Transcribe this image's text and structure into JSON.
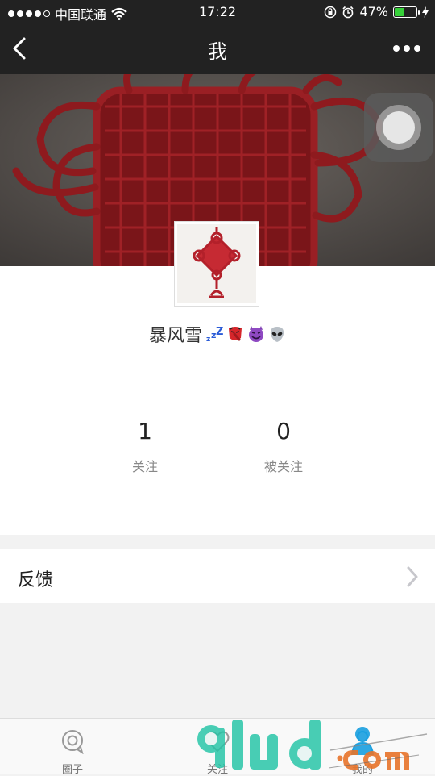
{
  "status_bar": {
    "carrier": "中国联通",
    "time": "17:22",
    "battery": "47%",
    "battery_level": 0.47
  },
  "nav": {
    "title": "我"
  },
  "profile": {
    "username": "暴风雪",
    "following_count": "1",
    "following_label": "关注",
    "followers_count": "0",
    "followers_label": "被关注"
  },
  "menu": {
    "feedback_label": "反馈"
  },
  "tabbar": {
    "tabs": [
      {
        "label": "圈子",
        "icon": "chat-bubble-icon"
      },
      {
        "label": "关注",
        "icon": "heart-icon"
      },
      {
        "label": "我的",
        "icon": "person-icon"
      }
    ]
  },
  "colors": {
    "header_bg": "#222222",
    "battery_green": "#37d13a",
    "knot_red": "#a01e24"
  }
}
